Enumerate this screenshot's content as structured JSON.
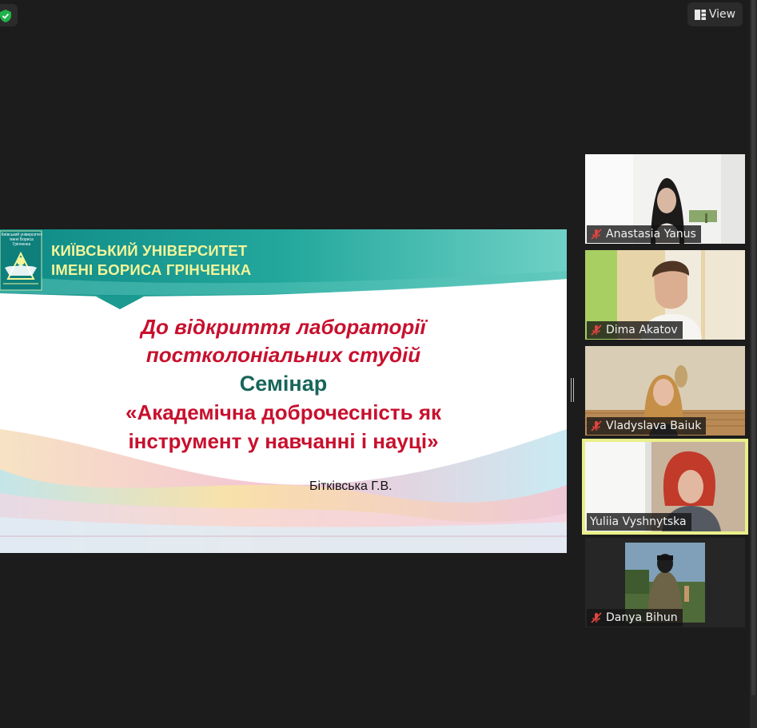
{
  "toolbar": {
    "view_label": "View"
  },
  "slide": {
    "university_line1": "КИЇВСЬКИЙ УНІВЕРСИТЕТ",
    "university_line2": "ІМЕНІ БОРИСА ГРІНЧЕНКА",
    "logo_text_line1": "Київський університет",
    "logo_text_line2": "імені Бориса Грінченка",
    "title_line1": "До відкриття лабораторії",
    "title_line2": "постколоніальних студій",
    "title_line3": "Семінар",
    "title_line4": "«Академічна доброчесність як",
    "title_line5": "інструмент у навчанні і науці»",
    "author": "Бітківська Г.В."
  },
  "participants": [
    {
      "name": "Anastasia Yanus",
      "muted": true,
      "active": false
    },
    {
      "name": "Dima Akatov",
      "muted": true,
      "active": false
    },
    {
      "name": "Vladyslava Baiuk",
      "muted": true,
      "active": false
    },
    {
      "name": "Yuliia Vyshnytska",
      "muted": false,
      "active": true
    },
    {
      "name": "Danya Bihun",
      "muted": true,
      "active": false
    }
  ],
  "colors": {
    "background": "#1c1c1c",
    "active_speaker_border": "#e9ef8a",
    "muted_icon": "#e0443e",
    "shield_green": "#21b24b",
    "slide_red": "#c8102e",
    "slide_green": "#17655a",
    "university_yellow": "#f3f59a"
  }
}
